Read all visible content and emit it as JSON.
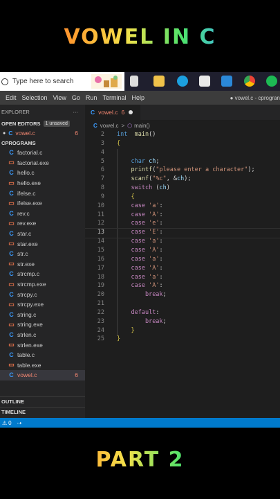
{
  "overlay": {
    "top_title": "VOWEL IN C",
    "bottom_title": "PART 2"
  },
  "taskbar": {
    "search_placeholder": "Type here to search"
  },
  "menubar": {
    "items": [
      "Edit",
      "Selection",
      "View",
      "Go",
      "Run",
      "Terminal",
      "Help"
    ],
    "window_title": "● vowel.c - cprogran"
  },
  "sidebar": {
    "explorer_label": "EXPLORER",
    "more": "···",
    "open_editors_label": "OPEN EDITORS",
    "unsaved_badge": "1 unsaved",
    "open_editor": {
      "dot": "●",
      "icon": "C",
      "name": "vowel.c",
      "problems": "6"
    },
    "project_label": "CPROGRAMS",
    "files": [
      {
        "name": "factorial.c",
        "type": "c"
      },
      {
        "name": "factorial.exe",
        "type": "exe"
      },
      {
        "name": "hello.c",
        "type": "c"
      },
      {
        "name": "hello.exe",
        "type": "exe"
      },
      {
        "name": "ifelse.c",
        "type": "c"
      },
      {
        "name": "ifelse.exe",
        "type": "exe"
      },
      {
        "name": "rev.c",
        "type": "c"
      },
      {
        "name": "rev.exe",
        "type": "exe"
      },
      {
        "name": "star.c",
        "type": "c"
      },
      {
        "name": "star.exe",
        "type": "exe"
      },
      {
        "name": "str.c",
        "type": "c"
      },
      {
        "name": "str.exe",
        "type": "exe"
      },
      {
        "name": "strcmp.c",
        "type": "c"
      },
      {
        "name": "strcmp.exe",
        "type": "exe"
      },
      {
        "name": "strcpy.c",
        "type": "c"
      },
      {
        "name": "strcpy.exe",
        "type": "exe"
      },
      {
        "name": "string.c",
        "type": "c"
      },
      {
        "name": "string.exe",
        "type": "exe"
      },
      {
        "name": "strlen.c",
        "type": "c"
      },
      {
        "name": "strlen.exe",
        "type": "exe"
      },
      {
        "name": "table.c",
        "type": "c"
      },
      {
        "name": "table.exe",
        "type": "exe"
      },
      {
        "name": "vowel.c",
        "type": "c",
        "active": true,
        "problems": "6"
      }
    ],
    "outline_label": "OUTLINE",
    "timeline_label": "TIMELINE"
  },
  "editor": {
    "tab": {
      "icon": "C",
      "name": "vowel.c",
      "problems": "6"
    },
    "breadcrumb": {
      "file": "vowel.c",
      "sep": ">",
      "symbol_icon": "⬡",
      "symbol": "main()"
    },
    "current_line": 13,
    "lines": [
      {
        "n": "2",
        "tokens": [
          [
            "kw",
            "int"
          ],
          [
            "",
            "  "
          ],
          [
            "fn",
            "main"
          ],
          [
            "",
            "()"
          ]
        ]
      },
      {
        "n": "3",
        "tokens": [
          [
            "brace",
            "{"
          ]
        ]
      },
      {
        "n": "4",
        "tokens": []
      },
      {
        "n": "5",
        "tokens": [
          [
            "",
            "    "
          ],
          [
            "kw",
            "char"
          ],
          [
            "",
            " "
          ],
          [
            "var",
            "ch"
          ],
          [
            "",
            ";"
          ]
        ]
      },
      {
        "n": "6",
        "tokens": [
          [
            "",
            "    "
          ],
          [
            "fn",
            "printf"
          ],
          [
            "",
            "("
          ],
          [
            "str",
            "\"please enter a character\""
          ],
          [
            "",
            ");"
          ]
        ]
      },
      {
        "n": "7",
        "tokens": [
          [
            "",
            "    "
          ],
          [
            "fn",
            "scanf"
          ],
          [
            "",
            "("
          ],
          [
            "str",
            "\"%c\""
          ],
          [
            "",
            ", &"
          ],
          [
            "var",
            "ch"
          ],
          [
            "",
            ");"
          ]
        ]
      },
      {
        "n": "8",
        "tokens": [
          [
            "",
            "    "
          ],
          [
            "kw2",
            "switch"
          ],
          [
            "",
            " ("
          ],
          [
            "var",
            "ch"
          ],
          [
            "",
            ")"
          ]
        ]
      },
      {
        "n": "9",
        "tokens": [
          [
            "",
            "    "
          ],
          [
            "brace",
            "{"
          ]
        ]
      },
      {
        "n": "10",
        "tokens": [
          [
            "",
            "    "
          ],
          [
            "kw2",
            "case"
          ],
          [
            "",
            " "
          ],
          [
            "str",
            "'a'"
          ],
          [
            "",
            ":"
          ]
        ]
      },
      {
        "n": "11",
        "tokens": [
          [
            "",
            "    "
          ],
          [
            "kw2",
            "case"
          ],
          [
            "",
            " "
          ],
          [
            "str",
            "'A'"
          ],
          [
            "",
            ":"
          ]
        ]
      },
      {
        "n": "12",
        "tokens": [
          [
            "",
            "    "
          ],
          [
            "kw2",
            "case"
          ],
          [
            "",
            " "
          ],
          [
            "str",
            "'e'"
          ],
          [
            "",
            ":"
          ]
        ]
      },
      {
        "n": "13",
        "tokens": [
          [
            "",
            "    "
          ],
          [
            "kw2",
            "case"
          ],
          [
            "",
            " "
          ],
          [
            "str",
            "'E'"
          ],
          [
            "",
            ":"
          ]
        ]
      },
      {
        "n": "14",
        "tokens": [
          [
            "",
            "    "
          ],
          [
            "kw2",
            "case"
          ],
          [
            "",
            " "
          ],
          [
            "str",
            "'a'"
          ],
          [
            "",
            ":"
          ]
        ]
      },
      {
        "n": "15",
        "tokens": [
          [
            "",
            "    "
          ],
          [
            "kw2",
            "case"
          ],
          [
            "",
            " "
          ],
          [
            "str",
            "'A'"
          ],
          [
            "",
            ":"
          ]
        ]
      },
      {
        "n": "16",
        "tokens": [
          [
            "",
            "    "
          ],
          [
            "kw2",
            "case"
          ],
          [
            "",
            " "
          ],
          [
            "str",
            "'a'"
          ],
          [
            "",
            ":"
          ]
        ]
      },
      {
        "n": "17",
        "tokens": [
          [
            "",
            "    "
          ],
          [
            "kw2",
            "case"
          ],
          [
            "",
            " "
          ],
          [
            "str",
            "'A'"
          ],
          [
            "",
            ":"
          ]
        ]
      },
      {
        "n": "18",
        "tokens": [
          [
            "",
            "    "
          ],
          [
            "kw2",
            "case"
          ],
          [
            "",
            " "
          ],
          [
            "str",
            "'a'"
          ],
          [
            "",
            ":"
          ]
        ]
      },
      {
        "n": "19",
        "tokens": [
          [
            "",
            "    "
          ],
          [
            "kw2",
            "case"
          ],
          [
            "",
            " "
          ],
          [
            "str",
            "'A'"
          ],
          [
            "",
            ":"
          ]
        ]
      },
      {
        "n": "20",
        "tokens": [
          [
            "",
            "        "
          ],
          [
            "kw2",
            "break"
          ],
          [
            "",
            ";"
          ]
        ]
      },
      {
        "n": "21",
        "tokens": []
      },
      {
        "n": "22",
        "tokens": [
          [
            "",
            "    "
          ],
          [
            "kw2",
            "default"
          ],
          [
            "",
            ":"
          ]
        ]
      },
      {
        "n": "23",
        "tokens": [
          [
            "",
            "        "
          ],
          [
            "kw2",
            "break"
          ],
          [
            "",
            ";"
          ]
        ]
      },
      {
        "n": "24",
        "tokens": [
          [
            "",
            "    "
          ],
          [
            "brace",
            "}"
          ]
        ]
      },
      {
        "n": "25",
        "tokens": [
          [
            "brace",
            "}"
          ]
        ]
      }
    ]
  },
  "statusbar": {
    "problems_icon": "⚠",
    "problems": "0",
    "live_icon": "⇢"
  }
}
